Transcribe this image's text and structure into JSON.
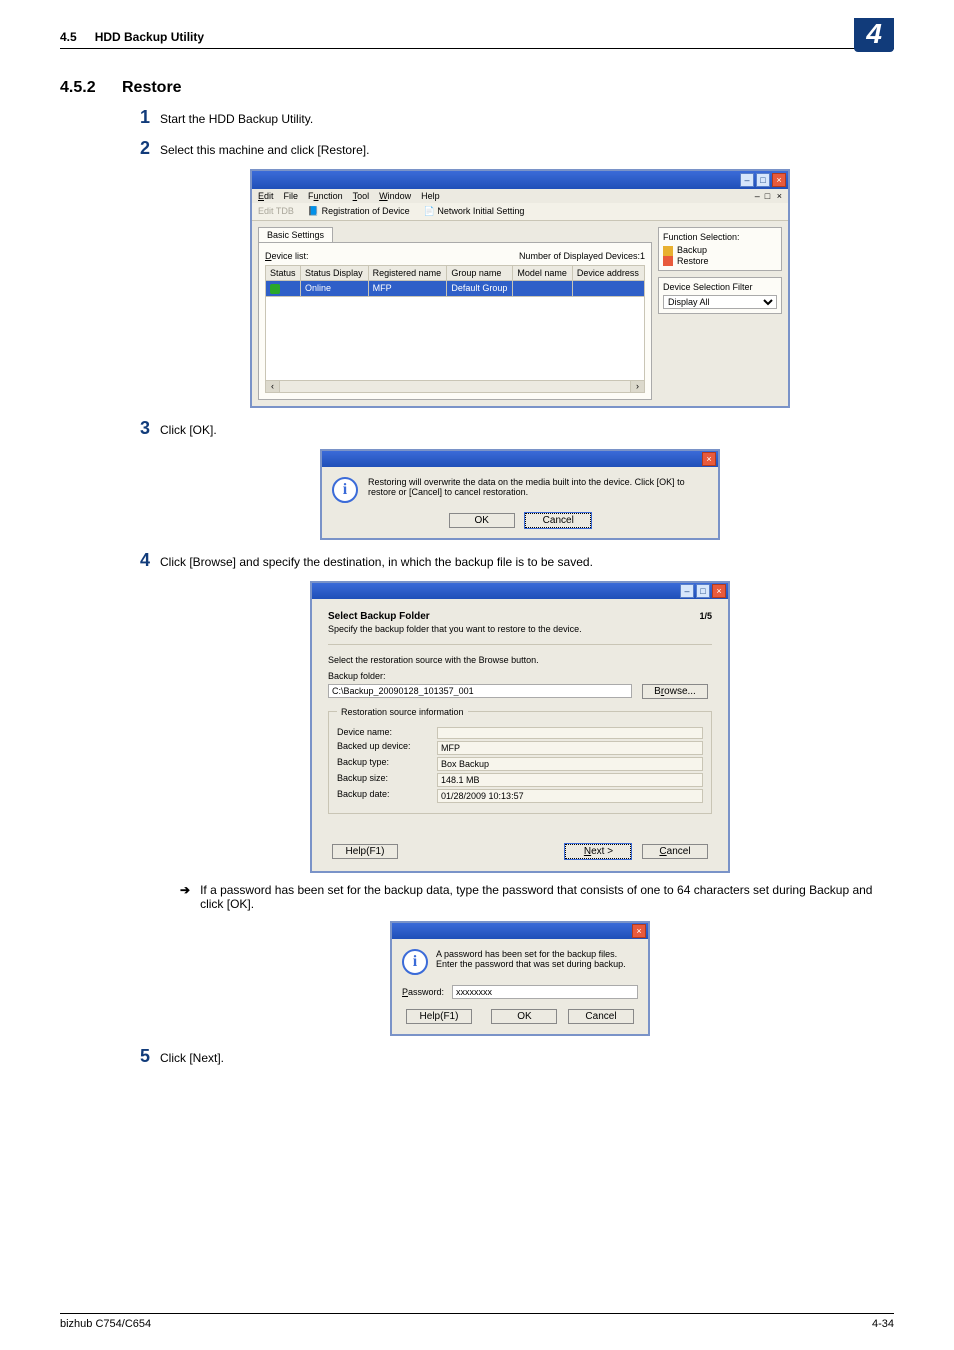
{
  "header": {
    "section_num": "4.5",
    "section_title": "HDD Backup Utility",
    "chapter_badge": "4"
  },
  "title": {
    "num": "4.5.2",
    "text": "Restore"
  },
  "steps": {
    "s1": {
      "n": "1",
      "t": "Start the HDD Backup Utility."
    },
    "s2": {
      "n": "2",
      "t": "Select this machine and click [Restore]."
    },
    "s3": {
      "n": "3",
      "t": "Click [OK]."
    },
    "s4": {
      "n": "4",
      "t": "Click [Browse] and specify the destination, in which the backup file is to be saved."
    },
    "s4_sub": "If a password has been set for the backup data, type the password that consists of one to 64 characters set during Backup and click [OK].",
    "s5": {
      "n": "5",
      "t": "Click [Next]."
    }
  },
  "ss1": {
    "menu": {
      "edit": "Edit",
      "file": "File",
      "function": "Function",
      "tool": "Tool",
      "window": "Window",
      "help": "Help"
    },
    "restore_x": "×",
    "toolbar": {
      "edit_tdb": "Edit TDB",
      "reg": "Registration of Device",
      "net": "Network Initial Setting"
    },
    "tab": "Basic Settings",
    "device_list": "Device list:",
    "num_disp": "Number of Displayed Devices:1",
    "cols": {
      "status": "Status",
      "status_disp": "Status Display",
      "regname": "Registered name",
      "group": "Group name",
      "model": "Model name",
      "addr": "Device address"
    },
    "row": {
      "status_disp": "Online",
      "regname": "MFP",
      "group": "Default Group",
      "model": "",
      "addr": ""
    },
    "side": {
      "fs_title": "Function Selection:",
      "backup": "Backup",
      "restore": "Restore",
      "dsf_title": "Device Selection Filter",
      "display_all": "Display All"
    }
  },
  "ss2": {
    "msg": "Restoring will overwrite the data on the media built into the device. Click [OK] to restore or [Cancel] to cancel restoration.",
    "ok": "OK",
    "cancel": "Cancel"
  },
  "ss3": {
    "title": "Select Backup Folder",
    "sub": "Specify the backup folder that you want to restore to the device.",
    "step": "1/5",
    "instr": "Select the restoration source with the Browse button.",
    "folder_lbl": "Backup folder:",
    "folder_val": "C:\\Backup_20090128_101357_001",
    "browse": "Browse...",
    "grp_title": "Restoration source information",
    "rows": {
      "dn_k": "Device name:",
      "dn_v": "",
      "bd_k": "Backed up device:",
      "bd_v": "MFP",
      "bt_k": "Backup type:",
      "bt_v": "Box Backup",
      "bs_k": "Backup size:",
      "bs_v": "148.1 MB",
      "bdt_k": "Backup date:",
      "bdt_v": "01/28/2009 10:13:57"
    },
    "help": "Help(F1)",
    "next": "Next >",
    "cancel": "Cancel"
  },
  "ss4": {
    "msg": "A password has been set for the backup files.\nEnter the password that was set during backup.",
    "pw_lbl": "Password:",
    "pw_val": "xxxxxxxx",
    "help": "Help(F1)",
    "ok": "OK",
    "cancel": "Cancel"
  },
  "footer": {
    "left": "bizhub C754/C654",
    "right": "4-34"
  }
}
